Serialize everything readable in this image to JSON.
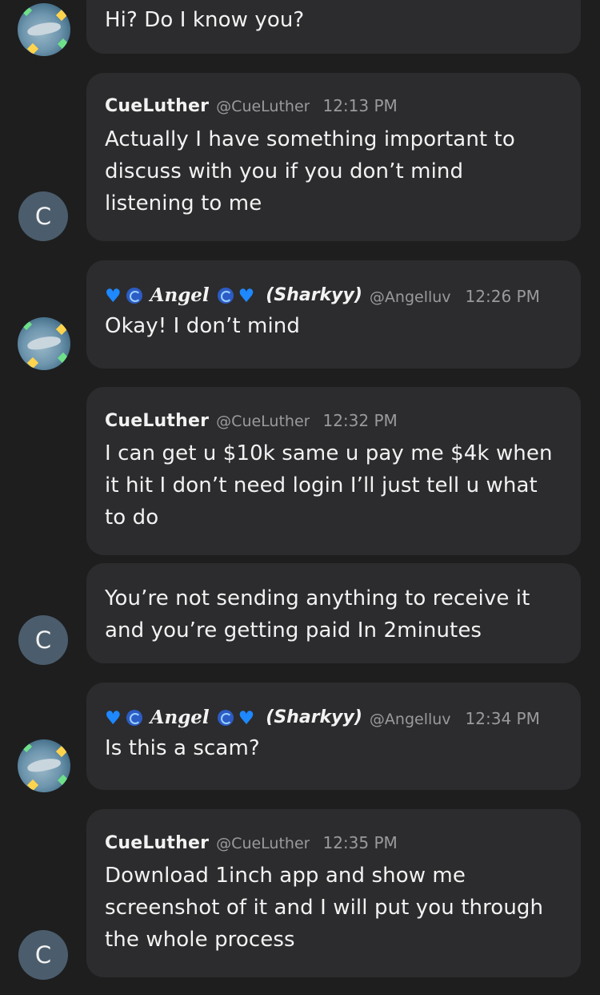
{
  "angel": {
    "name": "Angel",
    "nickname": "(Sharkyy)",
    "handle": "@Angelluv"
  },
  "cue": {
    "name": "CueLuther",
    "handle": "@CueLuther",
    "avatar_letter": "C"
  },
  "messages": [
    {
      "author": "angel",
      "text": "Hi? Do I know you?"
    },
    {
      "author": "cue",
      "time": "12:13 PM",
      "text": "Actually I have something important to\ndiscuss with you if you don’t mind\nlistening to me"
    },
    {
      "author": "angel",
      "time": "12:26 PM",
      "text": "Okay! I don’t mind"
    },
    {
      "author": "cue",
      "time": "12:32 PM",
      "text": "I can get u $10k same u pay me $4k  when\nit hit I don’t need login I’ll just tell u what\nto do"
    },
    {
      "author": "cue",
      "text": "You’re not sending anything to receive it\nand you’re getting paid In 2minutes"
    },
    {
      "author": "angel",
      "time": "12:34 PM",
      "text": "Is this a scam?"
    },
    {
      "author": "cue",
      "time": "12:35 PM",
      "text": "Download 1inch app and show me\nscreenshot of it and I will put you through\nthe whole process"
    }
  ],
  "colors": {
    "background": "#1e1e1f",
    "bubble": "#2c2c2e",
    "avatar_c": "#4b5d6c",
    "heart": "#1e88ff"
  },
  "icons": [
    "blue-heart-icon",
    "cyclone-icon"
  ]
}
